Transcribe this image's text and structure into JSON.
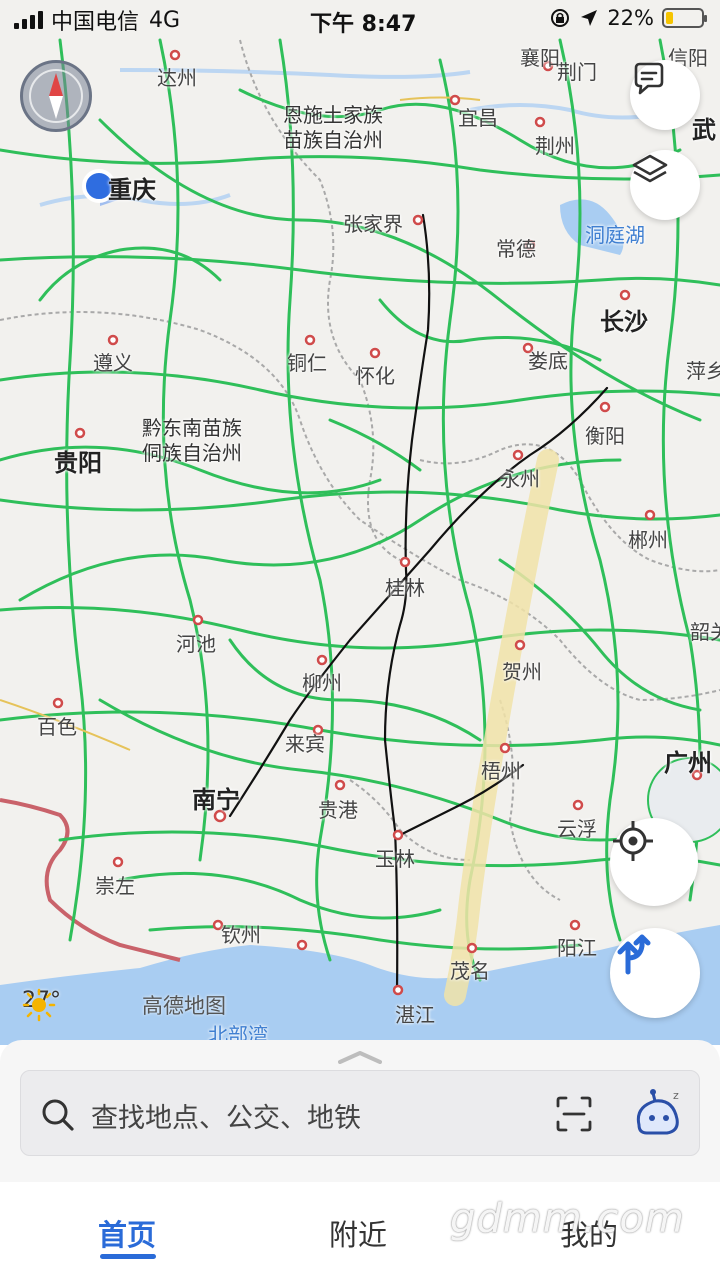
{
  "status_bar": {
    "carrier": "中国电信",
    "network": "4G",
    "time": "下午 8:47",
    "battery": "22%",
    "battery_level": 0.22
  },
  "map": {
    "labels": {
      "dazhou": "达州",
      "enshi": "恩施土家族\n苗族自治州",
      "yichang": "宜昌",
      "jingmen": "荆门",
      "jingzhou": "荆州",
      "chongqing": "重庆",
      "zhangjiajie": "张家界",
      "changde": "常德",
      "dongtinghu": "洞庭湖",
      "changsha": "长沙",
      "zunyi": "遵义",
      "tongren": "铜仁",
      "huaihua": "怀化",
      "loudi": "娄底",
      "pingxiang": "萍乡",
      "qiandongnan": "黔东南苗族\n侗族自治州",
      "guiyang": "贵阳",
      "hengyang": "衡阳",
      "yongzhou": "永州",
      "chenzhou": "郴州",
      "guilin": "桂林",
      "shaoguan": "韶关",
      "hechi": "河池",
      "hezhou": "贺州",
      "liuzhou": "柳州",
      "baise": "百色",
      "laibin": "来宾",
      "wuzhou": "梧州",
      "guangzhou": "广州",
      "nanning": "南宁",
      "guigang": "贵港",
      "yunfu": "云浮",
      "yulin": "玉林",
      "chongzuo": "崇左",
      "qinzhou": "钦州",
      "yangjiang": "阳江",
      "maoming": "茂名",
      "zhanjiang": "湛江",
      "beibuwan": "北部湾",
      "wuhan_partial": "武",
      "xiangyang_partial": "襄阳",
      "xinyang_partial": "信阳"
    },
    "weather_temp": "27°",
    "brand": "高德地图",
    "colors": {
      "road": "#2fbf5a",
      "water": "#a9cdf2",
      "border": "#c9626a",
      "highlight": "#f1e3a8",
      "drawn_line": "#111111",
      "accent": "#2a6bd8"
    }
  },
  "controls": {
    "message_icon": "message-icon",
    "layers_icon": "layers-icon",
    "locate_icon": "locate-icon",
    "route_icon": "route-icon",
    "compass_icon": "compass-icon"
  },
  "search": {
    "placeholder": "查找地点、公交、地铁"
  },
  "tabs": [
    {
      "label": "首页",
      "active": true
    },
    {
      "label": "附近",
      "active": false
    },
    {
      "label": "我的",
      "active": false
    }
  ],
  "watermark": "gdmm.com"
}
